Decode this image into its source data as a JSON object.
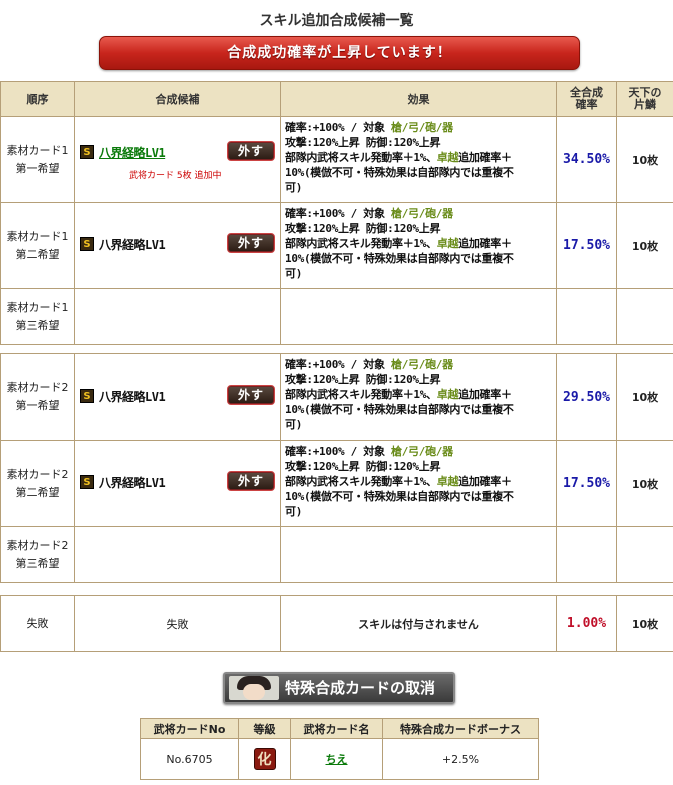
{
  "page_title": "スキル追加合成候補一覧",
  "banner": "合成成功確率が上昇しています！",
  "headers": {
    "order": "順序",
    "candidate": "合成候補",
    "effect": "効果",
    "rate": "全合成確率",
    "rate_line1": "全合成",
    "rate_line2": "確率",
    "count_line1": "天下の",
    "count_line2": "片鱗"
  },
  "rows": [
    {
      "order1": "素材カード1",
      "order2": "第一希望",
      "skill": "八界経略LV1",
      "note": "武将カード 5枚 追加中",
      "eff1a": "確率:+100% / 対象 ",
      "eff1b": "槍/弓/砲/器",
      "eff2": "攻撃:120%上昇 防御:120%上昇",
      "eff3a": "部隊内武将スキル発動率＋1%、",
      "eff3b": "卓越",
      "eff3c": "追加確率＋",
      "eff4": "10%(模倣不可・特殊効果は自部隊内では重複不",
      "eff5": "可)",
      "rate": "34.50%",
      "count": "10枚",
      "remove": "外す"
    },
    {
      "order1": "素材カード1",
      "order2": "第二希望",
      "skill": "八界経略LV1",
      "eff1a": "確率:+100% / 対象 ",
      "eff1b": "槍/弓/砲/器",
      "eff2": "攻撃:120%上昇 防御:120%上昇",
      "eff3a": "部隊内武将スキル発動率＋1%、",
      "eff3b": "卓越",
      "eff3c": "追加確率＋",
      "eff4": "10%(模倣不可・特殊効果は自部隊内では重複不",
      "eff5": "可)",
      "rate": "17.50%",
      "count": "10枚",
      "remove": "外す"
    },
    {
      "order1": "素材カード1",
      "order2": "第三希望"
    },
    {
      "order1": "素材カード2",
      "order2": "第一希望",
      "skill": "八界経略LV1",
      "eff1a": "確率:+100% / 対象 ",
      "eff1b": "槍/弓/砲/器",
      "eff2": "攻撃:120%上昇 防御:120%上昇",
      "eff3a": "部隊内武将スキル発動率＋1%、",
      "eff3b": "卓越",
      "eff3c": "追加確率＋",
      "eff4": "10%(模倣不可・特殊効果は自部隊内では重複不",
      "eff5": "可)",
      "rate": "29.50%",
      "count": "10枚",
      "remove": "外す"
    },
    {
      "order1": "素材カード2",
      "order2": "第二希望",
      "skill": "八界経略LV1",
      "eff1a": "確率:+100% / 対象 ",
      "eff1b": "槍/弓/砲/器",
      "eff2": "攻撃:120%上昇 防御:120%上昇",
      "eff3a": "部隊内武将スキル発動率＋1%、",
      "eff3b": "卓越",
      "eff3c": "追加確率＋",
      "eff4": "10%(模倣不可・特殊効果は自部隊内では重複不",
      "eff5": "可)",
      "rate": "17.50%",
      "count": "10枚",
      "remove": "外す"
    },
    {
      "order1": "素材カード2",
      "order2": "第三希望"
    }
  ],
  "fail_row": {
    "order": "失敗",
    "candidate": "失敗",
    "effect": "スキルは付与されません",
    "rate": "1.00%",
    "count": "10枚"
  },
  "skill_badge": "S",
  "cancel_button": "特殊合成カードの取消",
  "bonus_table": {
    "headers": [
      "武将カードNo",
      "等級",
      "武将カード名",
      "特殊合成カードボーナス"
    ],
    "card_no": "No.6705",
    "grade": "化",
    "card_name": "ちえ",
    "bonus": "+2.5%"
  },
  "colors": {
    "header_bg": "#ece2c2",
    "border": "#b59f78",
    "rate_blue": "#1a1aa8",
    "fail_red": "#c0102a",
    "target_green": "#6a8c1a",
    "banner_red": "#c8251c"
  }
}
